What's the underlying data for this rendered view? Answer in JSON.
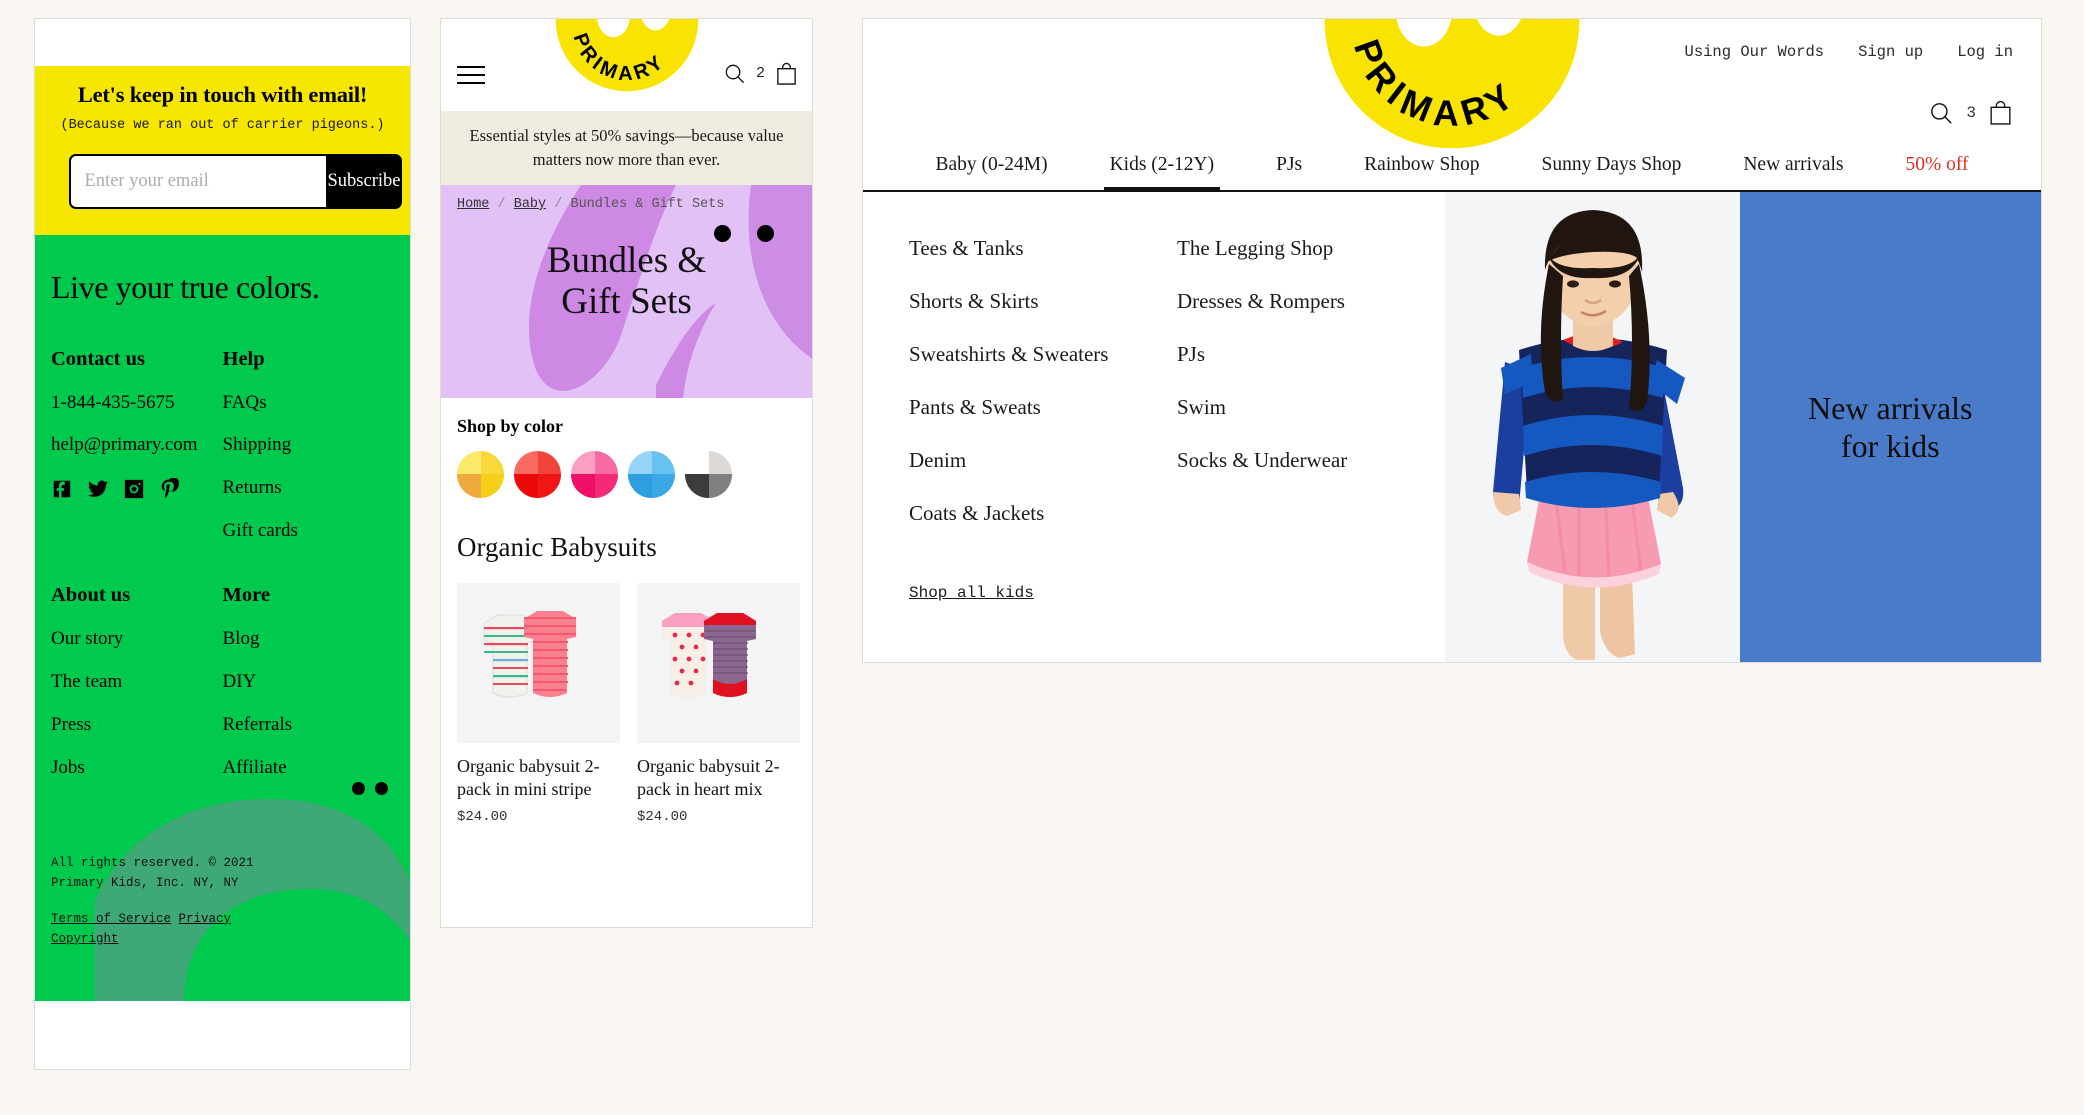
{
  "footer_card": {
    "newsletter": {
      "heading": "Let's keep in touch with email!",
      "sub": "(Because we ran out of carrier pigeons.)",
      "email_placeholder": "Enter your email",
      "email_value": "",
      "subscribe_label": "Subscribe",
      "bg_color": "#f7e600"
    },
    "tagline": "Live your true colors.",
    "bg_color": "#00ca4e",
    "columns": [
      {
        "heading": "Contact us",
        "items": [
          "1-844-435-5675",
          "help@primary.com"
        ]
      },
      {
        "heading": "Help",
        "items": [
          "FAQs",
          "Shipping",
          "Returns",
          "Gift cards"
        ]
      },
      {
        "heading": "About us",
        "items": [
          "Our story",
          "The team",
          "Press",
          "Jobs"
        ]
      },
      {
        "heading": "More",
        "items": [
          "Blog",
          "DIY",
          "Referrals",
          "Affiliate"
        ]
      }
    ],
    "socials": [
      "facebook-icon",
      "twitter-icon",
      "instagram-icon",
      "pinterest-icon"
    ],
    "legal_line1": "All rights reserved. © 2021",
    "legal_line2": "Primary Kids, Inc. NY, NY",
    "legal_links": [
      "Terms of Service",
      "Privacy",
      "Copyright"
    ]
  },
  "mobile_plp": {
    "logo_text": "PRIMARY",
    "cart_count": "2",
    "promo": "Essential styles at 50% savings—because value matters now more than ever.",
    "breadcrumb": {
      "home": "Home",
      "baby": "Baby",
      "current": "Bundles & Gift Sets",
      "sep": "/"
    },
    "hero_title_line1": "Bundles &",
    "hero_title_line2": "Gift Sets",
    "hero_bg": "#e0bdf5",
    "shop_by_color_label": "Shop by color",
    "swatches": [
      {
        "name": "yellow",
        "colors": [
          "#fbe96a",
          "#f7d93a",
          "#eeaa3c",
          "#f5cf18"
        ]
      },
      {
        "name": "red",
        "colors": [
          "#fa6a63",
          "#f3443c",
          "#ea0a0a",
          "#f01616"
        ]
      },
      {
        "name": "pink",
        "colors": [
          "#fa9fc2",
          "#f86aa4",
          "#ee1066",
          "#f42a78"
        ]
      },
      {
        "name": "blue",
        "colors": [
          "#95d4f7",
          "#67c2ef",
          "#2e9fe0",
          "#3aa8e5"
        ]
      },
      {
        "name": "grey",
        "colors": [
          "#ffffff",
          "#dcd9d6",
          "#3c3c3c",
          "#808080"
        ]
      }
    ],
    "section_title": "Organic Babysuits",
    "products": [
      {
        "title": "Organic babysuit 2-pack in mini stripe",
        "price": "$24.00"
      },
      {
        "title": "Organic babysuit 2-pack in heart mix",
        "price": "$24.00"
      }
    ]
  },
  "desktop_menu": {
    "logo_text": "PRIMARY",
    "util_links": [
      "Using Our Words",
      "Sign up",
      "Log in"
    ],
    "cart_count": "3",
    "nav": [
      {
        "label": "Baby (0-24M)",
        "active": false,
        "sale": false
      },
      {
        "label": "Kids (2-12Y)",
        "active": true,
        "sale": false
      },
      {
        "label": "PJs",
        "active": false,
        "sale": false
      },
      {
        "label": "Rainbow Shop",
        "active": false,
        "sale": false
      },
      {
        "label": "Sunny Days Shop",
        "active": false,
        "sale": false
      },
      {
        "label": "New arrivals",
        "active": false,
        "sale": false
      },
      {
        "label": "50% off",
        "active": false,
        "sale": true
      }
    ],
    "mega_col_1": [
      "Tees & Tanks",
      "Shorts & Skirts",
      "Sweatshirts & Sweaters",
      "Pants & Sweats",
      "Denim",
      "Coats & Jackets"
    ],
    "mega_col_2": [
      "The Legging Shop",
      "Dresses & Rompers",
      "PJs",
      "Swim",
      "Socks & Underwear"
    ],
    "shop_all_label": "Shop all kids",
    "cta_line1": "New arrivals",
    "cta_line2": "for kids",
    "cta_bg": "#4a7bc8",
    "sale_color": "#e03025"
  }
}
